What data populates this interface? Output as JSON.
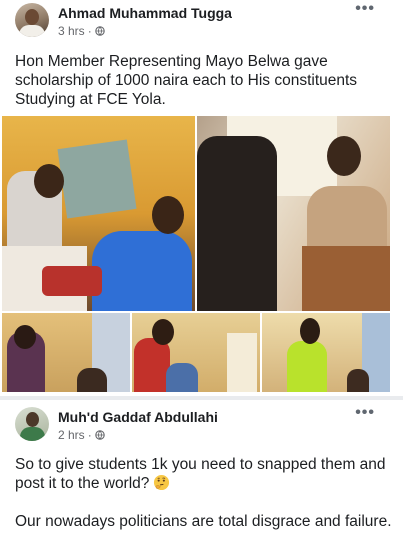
{
  "post": {
    "author": "Ahmad Muhammad Tugga",
    "time": "3 hrs",
    "separator": "·",
    "more_label": "•••",
    "text": "Hon Member Representing Mayo Belwa gave scholarship of 1000 naira each to His constituents Studying at FCE Yola.",
    "photos": [
      "photo-1",
      "photo-2",
      "photo-3",
      "photo-4",
      "photo-5"
    ]
  },
  "comment": {
    "author": "Muh'd Gaddaf Abdullahi",
    "time": "2 hrs",
    "separator": "·",
    "more_label": "•••",
    "paragraph_1": "So to give students 1k you need to snapped them and post it to the world?",
    "paragraph_2": "Our nowadays politicians are total disgrace and failure.",
    "emoji": "thinking-face-icon"
  },
  "colors": {
    "text": "#1c1e21",
    "meta": "#65676b",
    "divider": "#e9ebee"
  }
}
